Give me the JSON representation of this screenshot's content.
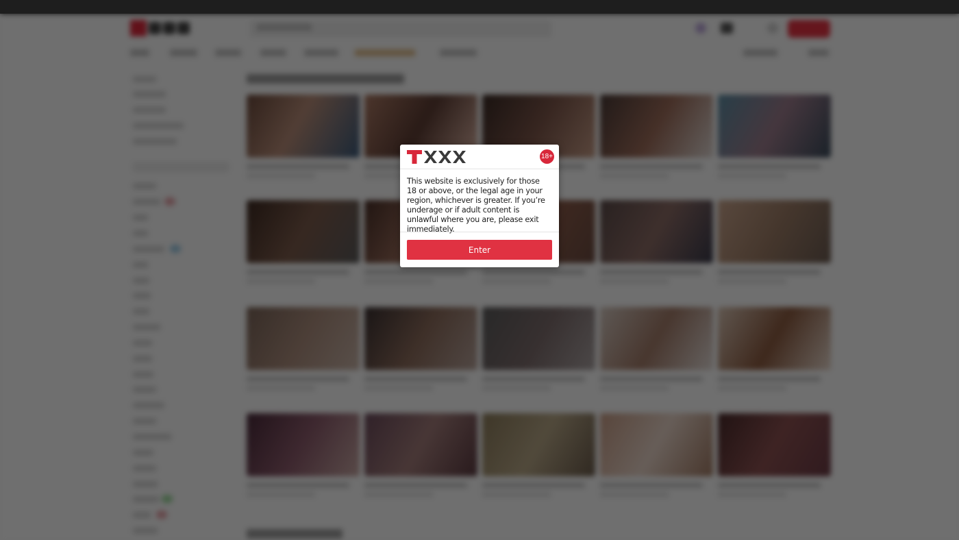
{
  "modal": {
    "logo_alt": "TXXX",
    "age_badge": "18+",
    "message": "This website is exclusively for those 18 or above, or the legal age in your region, whichever is greater. If you’re underage or if adult content is unlawful where you are, please exit immediately.",
    "enter_label": "Enter"
  },
  "colors": {
    "brand_red": "#d8273a",
    "button_red": "#e03242",
    "logo_dark": "#3a3a3a"
  },
  "icons": {
    "logo": "txxx-logo-icon",
    "age": "eighteen-plus-badge"
  }
}
